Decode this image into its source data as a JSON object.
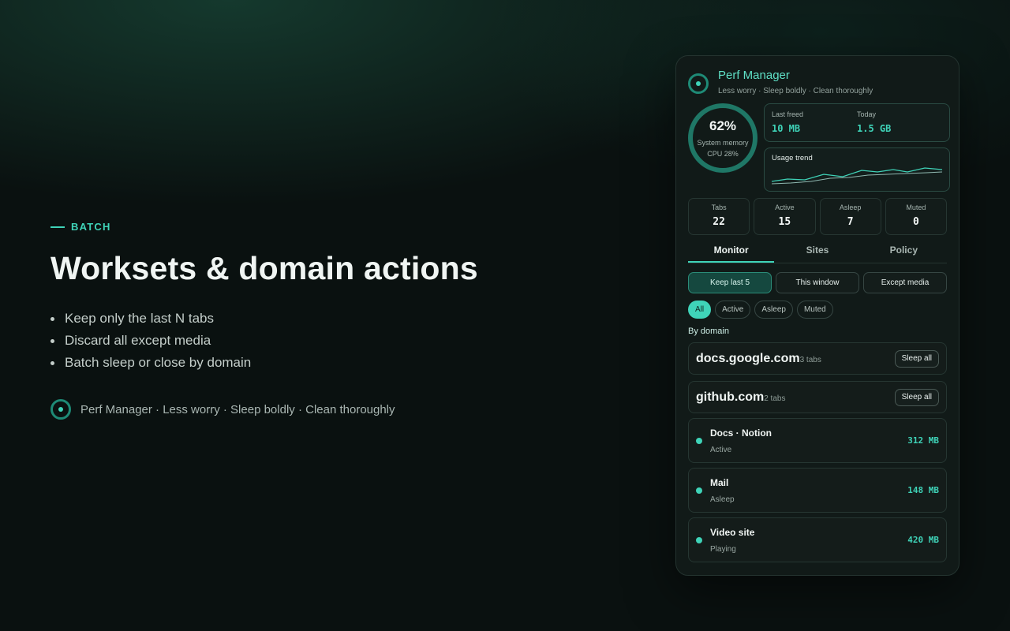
{
  "hero": {
    "eyebrow": "BATCH",
    "title": "Worksets & domain actions",
    "bullets": [
      "Keep only the last N tabs",
      "Discard all except media",
      "Batch sleep or close by domain"
    ],
    "brandline": "Perf Manager · Less worry · Sleep boldly · Clean thoroughly"
  },
  "panel": {
    "title": "Perf Manager",
    "subtitle": "Less worry · Sleep boldly · Clean thoroughly",
    "gauge": {
      "percent": "62%",
      "label": "System memory",
      "cpu": "CPU 28%"
    },
    "freed": {
      "last_label": "Last freed",
      "last_value": "10 MB",
      "today_label": "Today",
      "today_value": "1.5 GB"
    },
    "trend": {
      "label": "Usage trend"
    },
    "stats": [
      {
        "label": "Tabs",
        "value": "22"
      },
      {
        "label": "Active",
        "value": "15"
      },
      {
        "label": "Asleep",
        "value": "7"
      },
      {
        "label": "Muted",
        "value": "0"
      }
    ],
    "tabs": [
      "Monitor",
      "Sites",
      "Policy"
    ],
    "actions": [
      "Keep last 5",
      "This window",
      "Except media"
    ],
    "filters": [
      "All",
      "Active",
      "Asleep",
      "Muted"
    ],
    "by_domain_label": "By domain",
    "domains": [
      {
        "name": "docs.google.com",
        "count": "3 tabs",
        "button": "Sleep all"
      },
      {
        "name": "github.com",
        "count": "2 tabs",
        "button": "Sleep all"
      }
    ],
    "tab_items": [
      {
        "name": "Docs · Notion",
        "status": "Active",
        "memory": "312 MB"
      },
      {
        "name": "Mail",
        "status": "Asleep",
        "memory": "148 MB"
      },
      {
        "name": "Video site",
        "status": "Playing",
        "memory": "420 MB"
      }
    ],
    "accent_color": "#3fd3b8"
  }
}
